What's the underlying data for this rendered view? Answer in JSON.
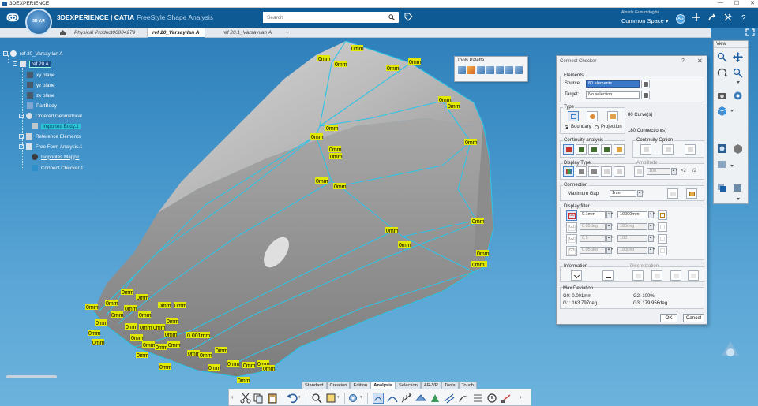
{
  "os": {
    "title": "3DEXPERIENCE",
    "min": "—",
    "max": "☐",
    "close": "✕"
  },
  "header": {
    "brand_bold": "3DEXPERIENCE | CATIA",
    "brand_app": "FreeStyle Shape Analysis",
    "compass_label": "3D  V,R",
    "search_placeholder": "Search",
    "user_name": "Alnadir Gunumdogdu",
    "space": "Common Space ▾",
    "avatar": "AG"
  },
  "tabs": [
    {
      "label": "Physical Product00004279",
      "active": false
    },
    {
      "label": "ref 20_Varsayılan A",
      "active": true
    },
    {
      "label": "ref 20.1_Varsayılan A",
      "active": false
    }
  ],
  "tree": {
    "root": "ref 20_Varsayılan A",
    "part": "ref 20 A",
    "xy": "xy plane",
    "yz": "yz plane",
    "zx": "zx plane",
    "partbody": "PartBody",
    "ordered": "Ordered Geometrical",
    "imported": "Imported Body.1",
    "reference": "Reference Elements",
    "ffa": "Free Form Analysis.1",
    "isophotes": "Isophotes Mappir",
    "connect": "Connect Checker.1"
  },
  "viewport": {
    "labels": [
      "0mm",
      "0.001mm"
    ]
  },
  "palette": {
    "title": "Tools Palette"
  },
  "dialog": {
    "title": "Connect Checker",
    "help": "?",
    "close": "✕",
    "elements_label": "Elements",
    "source_label": "Source:",
    "source_value": "80 elements",
    "target_label": "Target:",
    "target_value": "No selection",
    "type_label": "Type",
    "curves": "80 Curve(s)",
    "connections": "180 Connection(s)",
    "boundary": "Boundary",
    "projection": "Projection",
    "continuity_analysis": "Continuity analysis",
    "continuity_option": "Continuity Option",
    "display_type": "Display Type",
    "amplitude": "Amplitude",
    "amplitude_value": "100",
    "connection": "Connection",
    "max_gap_label": "Maximum Gap",
    "max_gap_value": "1mm",
    "display_filter": "Display filter",
    "filters": [
      {
        "tag": "G0",
        "min": "0.1mm",
        "max": "10000mm",
        "enabled": true
      },
      {
        "tag": "G1",
        "min": "0.05deg",
        "max": "180deg",
        "enabled": false
      },
      {
        "tag": "G2",
        "min": "0.5",
        "max": "100",
        "enabled": false
      },
      {
        "tag": "G3",
        "min": "0.05deg",
        "max": "180deg",
        "enabled": false
      }
    ],
    "information": "Information",
    "discretization": "Discretization",
    "max_deviation": "Max Deviation",
    "g0": "G0: 0.001mm",
    "g1": "G1: 163.797deg",
    "g2": "G2: 100%",
    "g3": "G3: 179.956deg",
    "ok": "OK",
    "cancel": "Cancel"
  },
  "right_toolbar": {
    "title": "View"
  },
  "action_tabs": [
    "Standard",
    "Creation",
    "Edition",
    "Analysis",
    "Selection",
    "AR-VR",
    "Tools",
    "Touch"
  ],
  "active_action_tab": "Analysis",
  "colors": {
    "header": "#0d5a94",
    "curve": "#2ec3e6",
    "label_bg": "#e3e800",
    "selection": "#3a78c9"
  }
}
